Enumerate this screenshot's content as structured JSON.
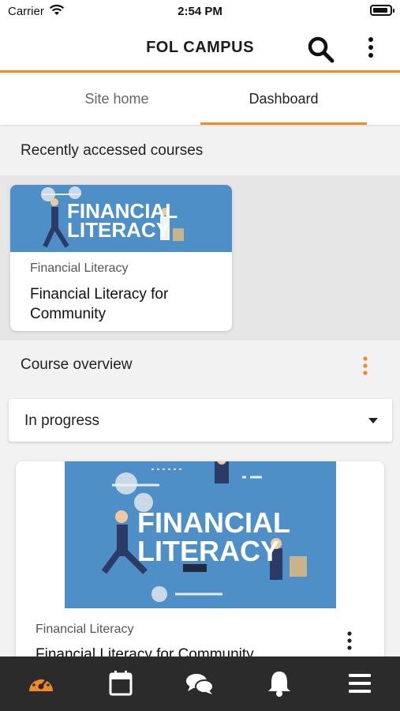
{
  "status_bar": {
    "carrier": "Carrier",
    "time": "2:54 PM",
    "battery_level": 0.9
  },
  "header": {
    "title": "FOL CAMPUS",
    "search_icon": "search-icon",
    "menu_icon": "more-vertical-icon"
  },
  "tabs": [
    {
      "label": "Site home",
      "active": false
    },
    {
      "label": "Dashboard",
      "active": true
    }
  ],
  "recent": {
    "section_title": "Recently accessed courses",
    "courses": [
      {
        "image_text": [
          "FINANCIAL",
          "LITERACY"
        ],
        "category": "Financial Literacy",
        "name": "Financial Literacy for Community"
      }
    ]
  },
  "overview": {
    "section_title": "Course overview",
    "menu_icon": "more-vertical-icon",
    "filter": {
      "selected": "In progress"
    },
    "courses": [
      {
        "image_text": [
          "FINANCIAL",
          "LITERACY"
        ],
        "category": "Financial Literacy",
        "name": "Financial Literacy for Community"
      }
    ]
  },
  "bottom_nav": [
    {
      "icon": "dashboard-gauge-icon",
      "active": true
    },
    {
      "icon": "calendar-icon",
      "active": false
    },
    {
      "icon": "messages-icon",
      "active": false
    },
    {
      "icon": "bell-icon",
      "active": false
    },
    {
      "icon": "menu-icon",
      "active": false
    }
  ],
  "colors": {
    "accent": "#f28a24",
    "nav_bg": "#2b2b2b",
    "image_bg": "#4f8fc7"
  }
}
